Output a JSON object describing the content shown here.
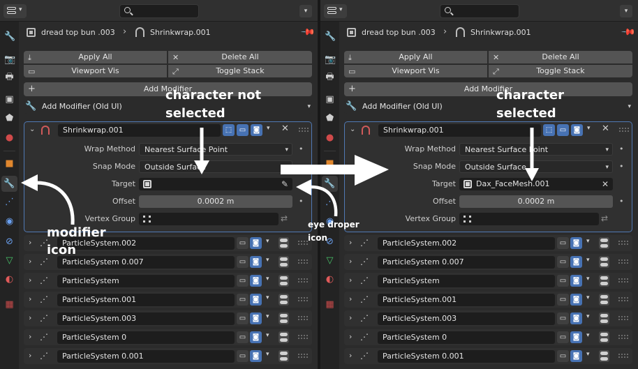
{
  "panels": {
    "left": {
      "breadcrumb": {
        "object": "dread top bun .003",
        "modifier": "Shrinkwrap.001"
      },
      "buttons": {
        "apply_all": "Apply All",
        "delete_all": "Delete All",
        "viewport_vis": "Viewport Vis",
        "toggle_stack": "Toggle Stack"
      },
      "add_modifier": "Add Modifier",
      "add_modifier_old": "Add Modifier (Old UI)",
      "modifier": {
        "name": "Shrinkwrap.001",
        "wrap_method_label": "Wrap Method",
        "wrap_method": "Nearest Surface Point",
        "snap_mode_label": "Snap Mode",
        "snap_mode": "Outside Surface",
        "target_label": "Target",
        "target": "",
        "offset_label": "Offset",
        "offset": "0.0002 m",
        "vertex_group_label": "Vertex Group",
        "vertex_group": ""
      },
      "particle_systems": [
        "ParticleSystem.002",
        "ParticleSystem 0.007",
        "ParticleSystem",
        "ParticleSystem.001",
        "ParticleSystem.003",
        "ParticleSystem 0",
        "ParticleSystem 0.001"
      ]
    },
    "right": {
      "breadcrumb": {
        "object": "dread top bun .003",
        "modifier": "Shrinkwrap.001"
      },
      "buttons": {
        "apply_all": "Apply All",
        "delete_all": "Delete All",
        "viewport_vis": "Viewport Vis",
        "toggle_stack": "Toggle Stack"
      },
      "add_modifier": "Add Modifier",
      "add_modifier_old": "Add Modifier (Old UI)",
      "modifier": {
        "name": "Shrinkwrap.001",
        "wrap_method_label": "Wrap Method",
        "wrap_method": "Nearest Surface Point",
        "snap_mode_label": "Snap Mode",
        "snap_mode": "Outside Surface",
        "target_label": "Target",
        "target": "Dax_FaceMesh.001",
        "offset_label": "Offset",
        "offset": "0.0002 m",
        "vertex_group_label": "Vertex Group",
        "vertex_group": ""
      },
      "particle_systems": [
        "ParticleSystem.002",
        "ParticleSystem 0.007",
        "ParticleSystem",
        "ParticleSystem.001",
        "ParticleSystem.003",
        "ParticleSystem 0",
        "ParticleSystem 0.001"
      ]
    }
  },
  "annotations": {
    "not_selected_1": "character not",
    "not_selected_2": "selected",
    "selected_1": "character",
    "selected_2": "selected",
    "modifier_1": "modifier",
    "modifier_2": "icon",
    "eyedropper_1": "eye droper",
    "eyedropper_2": "icon"
  },
  "colors": {
    "accent": "#4772b3",
    "panel_border": "#5079b4",
    "modifier_icon": "#d05a5a",
    "annotation": "#ffffff"
  },
  "sidebar_icons": [
    "tool-icon",
    "render-icon",
    "output-icon",
    "view-layer-icon",
    "scene-icon",
    "world-icon",
    "object-icon",
    "modifier-wrench-icon",
    "particles-icon",
    "physics-icon",
    "constraints-icon",
    "data-icon",
    "material-icon",
    "texture-icon"
  ]
}
